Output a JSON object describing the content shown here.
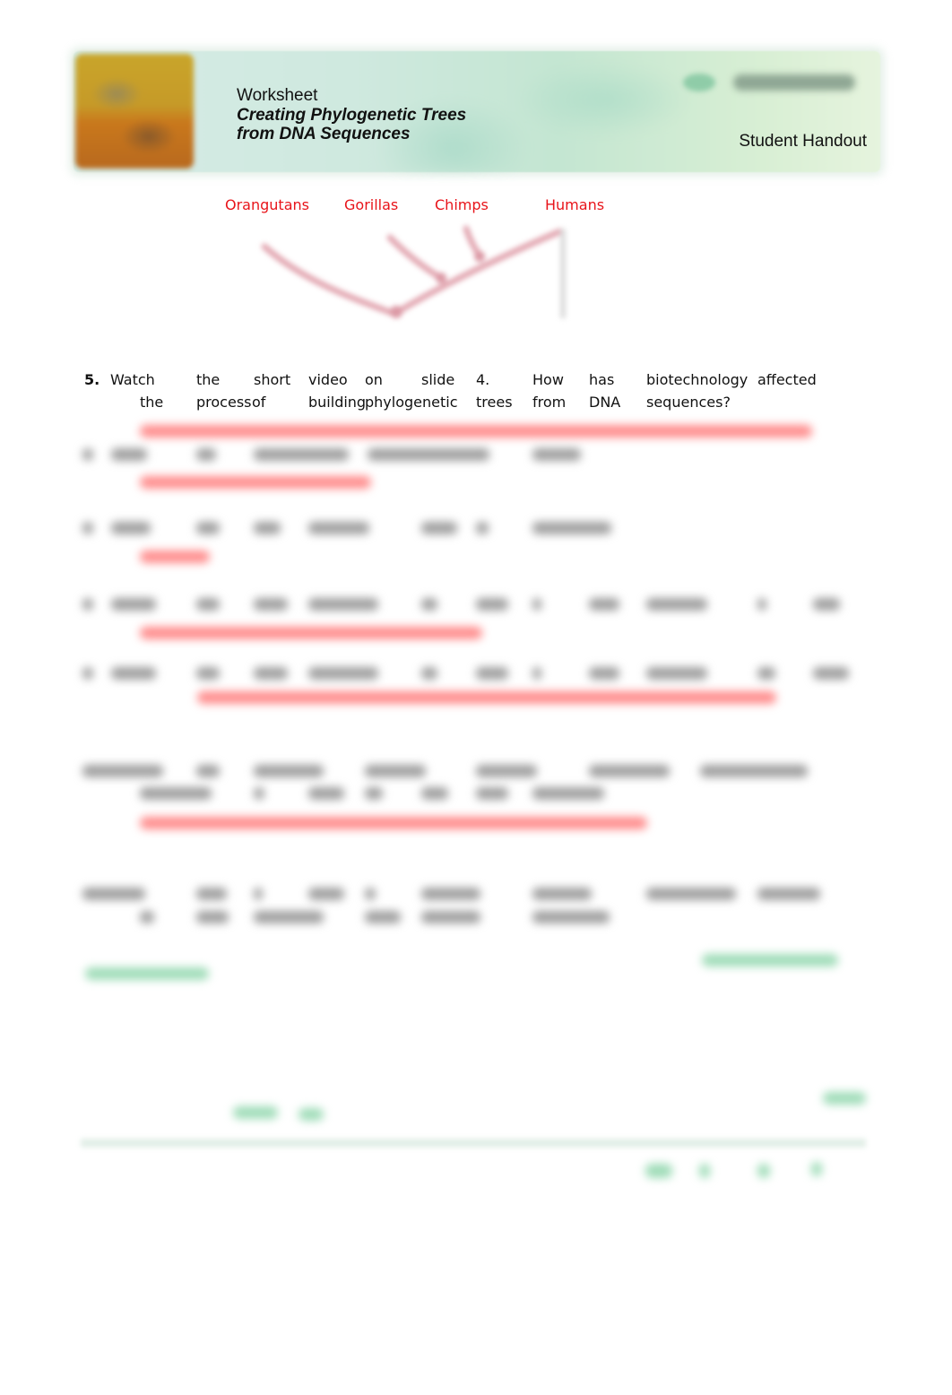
{
  "banner": {
    "kicker": "Worksheet",
    "title_line1": "Creating Phylogenetic Trees",
    "title_line2": "from DNA Sequences",
    "handout_label": "Student Handout",
    "logo": "publisher-logo (blurred)"
  },
  "tree": {
    "labels": [
      "Orangutans",
      "Gorillas",
      "Chimps",
      "Humans"
    ],
    "color": "#e8141a",
    "branch_color": "#e8b9c0"
  },
  "question5": {
    "number": "5.",
    "line1": [
      "Watch",
      "the",
      "short",
      "video",
      "on",
      "slide",
      "4.",
      "How",
      "has",
      "biotechnology",
      "affected"
    ],
    "line2": [
      "the",
      "process",
      "of",
      "building",
      "phylogenetic",
      "trees",
      "from",
      "DNA",
      "sequences?"
    ]
  },
  "obscured": {
    "note": "Remaining questions, answers and footer are blurred / unreadable in the source",
    "answer_color": "#ff8c8c",
    "question_color": "#9a9a9a",
    "footer_color": "#9fdcb8"
  }
}
